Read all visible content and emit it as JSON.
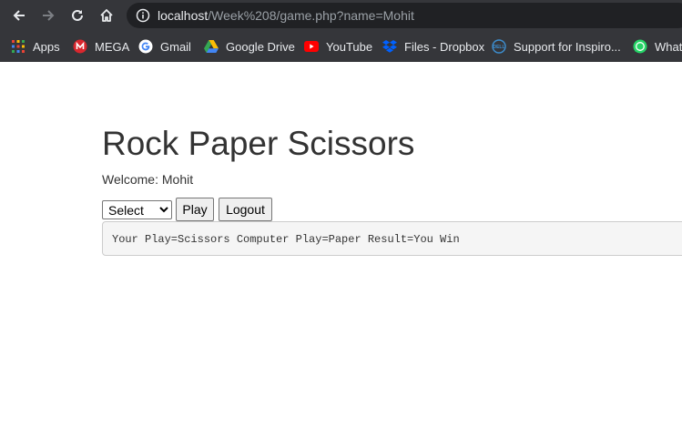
{
  "browser": {
    "url_host": "localhost",
    "url_path": "/Week%208/game.php?name=Mohit",
    "bookmarks": [
      {
        "label": "Apps",
        "icon": "apps-grid-icon"
      },
      {
        "label": "MEGA",
        "icon": "mega-icon"
      },
      {
        "label": "Gmail",
        "icon": "google-icon"
      },
      {
        "label": "Google Drive",
        "icon": "google-drive-icon"
      },
      {
        "label": "YouTube",
        "icon": "youtube-icon"
      },
      {
        "label": "Files - Dropbox",
        "icon": "dropbox-icon"
      },
      {
        "label": "Support for Inspiro...",
        "icon": "dell-icon"
      },
      {
        "label": "Whats",
        "icon": "whatsapp-icon"
      }
    ]
  },
  "page": {
    "title": "Rock Paper Scissors",
    "welcome": "Welcome: Mohit",
    "select_value": "Select",
    "play_label": "Play",
    "logout_label": "Logout",
    "result": "Your Play=Scissors Computer Play=Paper Result=You Win"
  }
}
